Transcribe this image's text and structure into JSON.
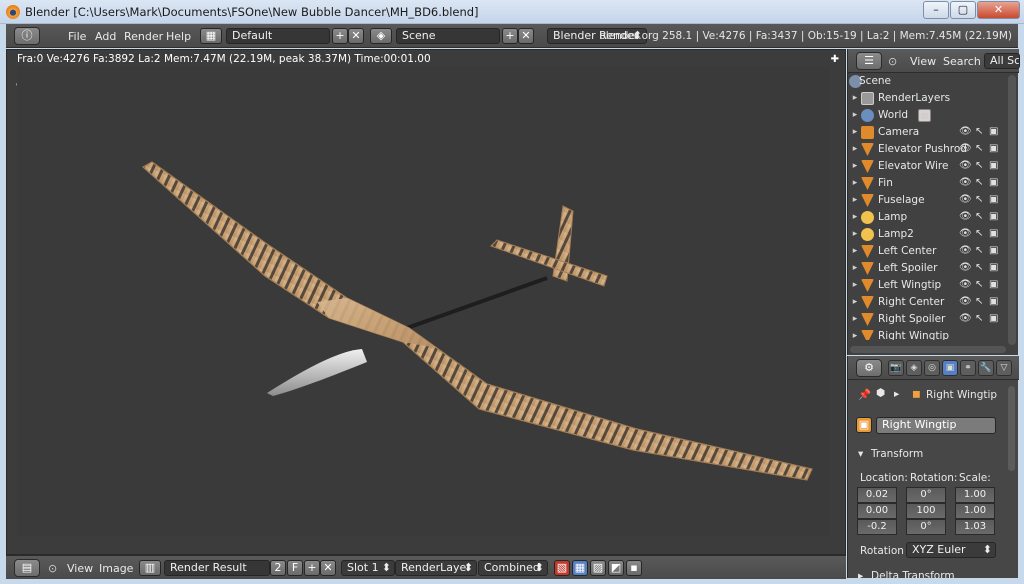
{
  "window": {
    "title": "Blender [C:\\Users\\Mark\\Documents\\FSOne\\New Bubble Dancer\\MH_BD6.blend]",
    "buttons": [
      "–",
      "▢",
      "✕"
    ]
  },
  "info_header": {
    "menus": [
      "File",
      "Add",
      "Render",
      "Help"
    ],
    "screen_layout": "Default",
    "scene": "Scene",
    "render_engine": "Blender Render",
    "stats": "blender.org 258.1 | Ve:4276 | Fa:3437 | Ob:15-19 | La:2 | Mem:7.45M (22.19M)"
  },
  "viewport": {
    "render_info": "Fra:0  Ve:4276 Fa:3892 La:2 Mem:7.47M (22.19M, peak 38.37M) Time:00:01.00"
  },
  "image_editor_header": {
    "menus": [
      "View",
      "Image"
    ],
    "image_name": "Render Result",
    "users": "2",
    "fake_user": "F",
    "slot": "Slot 1",
    "layer": "RenderLayer",
    "pass": "Combined"
  },
  "outliner": {
    "menus": [
      "View",
      "Search"
    ],
    "display_mode": "All Sce",
    "items": [
      {
        "label": "Scene",
        "icon": "scene-icon"
      },
      {
        "label": "RenderLayers",
        "icon": "render-layers-icon"
      },
      {
        "label": "World",
        "icon": "world-icon"
      },
      {
        "label": "Camera",
        "icon": "camera-icon"
      },
      {
        "label": "Elevator Pushrod",
        "icon": "mesh-icon"
      },
      {
        "label": "Elevator Wire",
        "icon": "mesh-icon"
      },
      {
        "label": "Fin",
        "icon": "mesh-icon"
      },
      {
        "label": "Fuselage",
        "icon": "mesh-icon"
      },
      {
        "label": "Lamp",
        "icon": "lamp-icon"
      },
      {
        "label": "Lamp2",
        "icon": "lamp-icon"
      },
      {
        "label": "Left Center",
        "icon": "mesh-icon"
      },
      {
        "label": "Left Spoiler",
        "icon": "mesh-icon"
      },
      {
        "label": "Left Wingtip",
        "icon": "mesh-icon"
      },
      {
        "label": "Right Center",
        "icon": "mesh-icon"
      },
      {
        "label": "Right Spoiler",
        "icon": "mesh-icon"
      },
      {
        "label": "Right Wingtip",
        "icon": "mesh-icon"
      }
    ]
  },
  "properties": {
    "context_object": "Right Wingtip",
    "object_name": "Right Wingtip",
    "transform_panel": "Transform",
    "columns": [
      "Location:",
      "Rotation:",
      "Scale:"
    ],
    "location": [
      "0.02",
      "0.00",
      "-0.2"
    ],
    "rotation": [
      "0°",
      "100",
      "0°"
    ],
    "scale": [
      "1.00",
      "1.00",
      "1.03"
    ],
    "rotation_mode_label": "Rotation",
    "rotation_mode": "XYZ Euler",
    "next_panel": "Delta Transform"
  },
  "colors": {
    "titlebar": "#c5d5ea",
    "header": "#4f4f4f",
    "viewport_bg": "#3a3a3a",
    "balsa": "#c9a276",
    "selected_tab": "#5680c2"
  }
}
